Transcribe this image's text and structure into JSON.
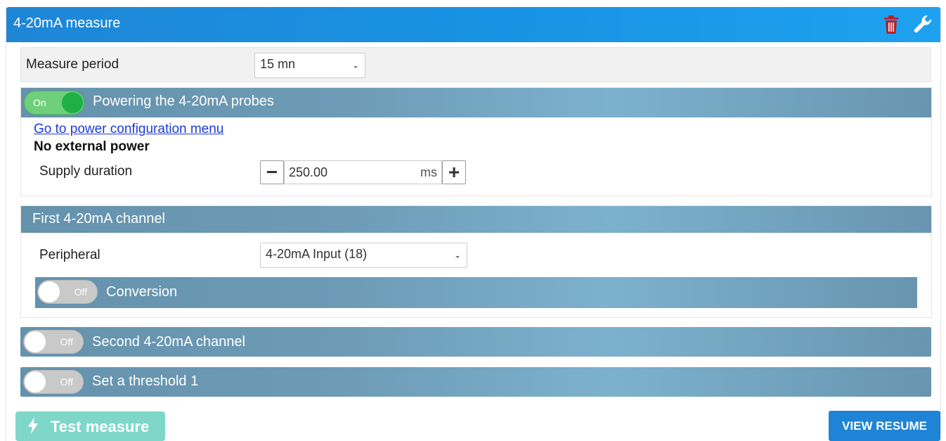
{
  "header": {
    "title": "4-20mA measure",
    "delete_icon": "trash-icon",
    "settings_icon": "wrench-icon",
    "delete_color": "#b5202a"
  },
  "measure_period": {
    "label": "Measure period",
    "value": "15 mn"
  },
  "powering": {
    "toggle_text": "On",
    "toggle_state": true,
    "title": "Powering the 4-20mA probes",
    "link_text": "Go to power configuration menu",
    "status_text": "No external power",
    "supply_label": "Supply duration",
    "supply_value": "250.00",
    "supply_unit": "ms",
    "decrement_label": "−",
    "increment_label": "+"
  },
  "first_channel": {
    "title": "First 4-20mA channel",
    "peripheral_label": "Peripheral",
    "peripheral_value": "4-20mA Input (18)",
    "conversion_toggle_text": "Off",
    "conversion_toggle_state": false,
    "conversion_title": "Conversion"
  },
  "second_channel": {
    "toggle_text": "Off",
    "toggle_state": false,
    "title": "Second 4-20mA channel"
  },
  "threshold": {
    "toggle_text": "Off",
    "toggle_state": false,
    "title": "Set a threshold 1"
  },
  "footer": {
    "test_label": "Test measure",
    "test_icon": "bolt-icon",
    "view_label": "VIEW RESUME"
  },
  "colors": {
    "header_blue": "#1893e4",
    "section_bar": "#6d9bb6",
    "toggle_on": "#1fb043",
    "test_button": "#7ed7c9",
    "view_button": "#1f84d5",
    "link": "#1f3bd6"
  }
}
